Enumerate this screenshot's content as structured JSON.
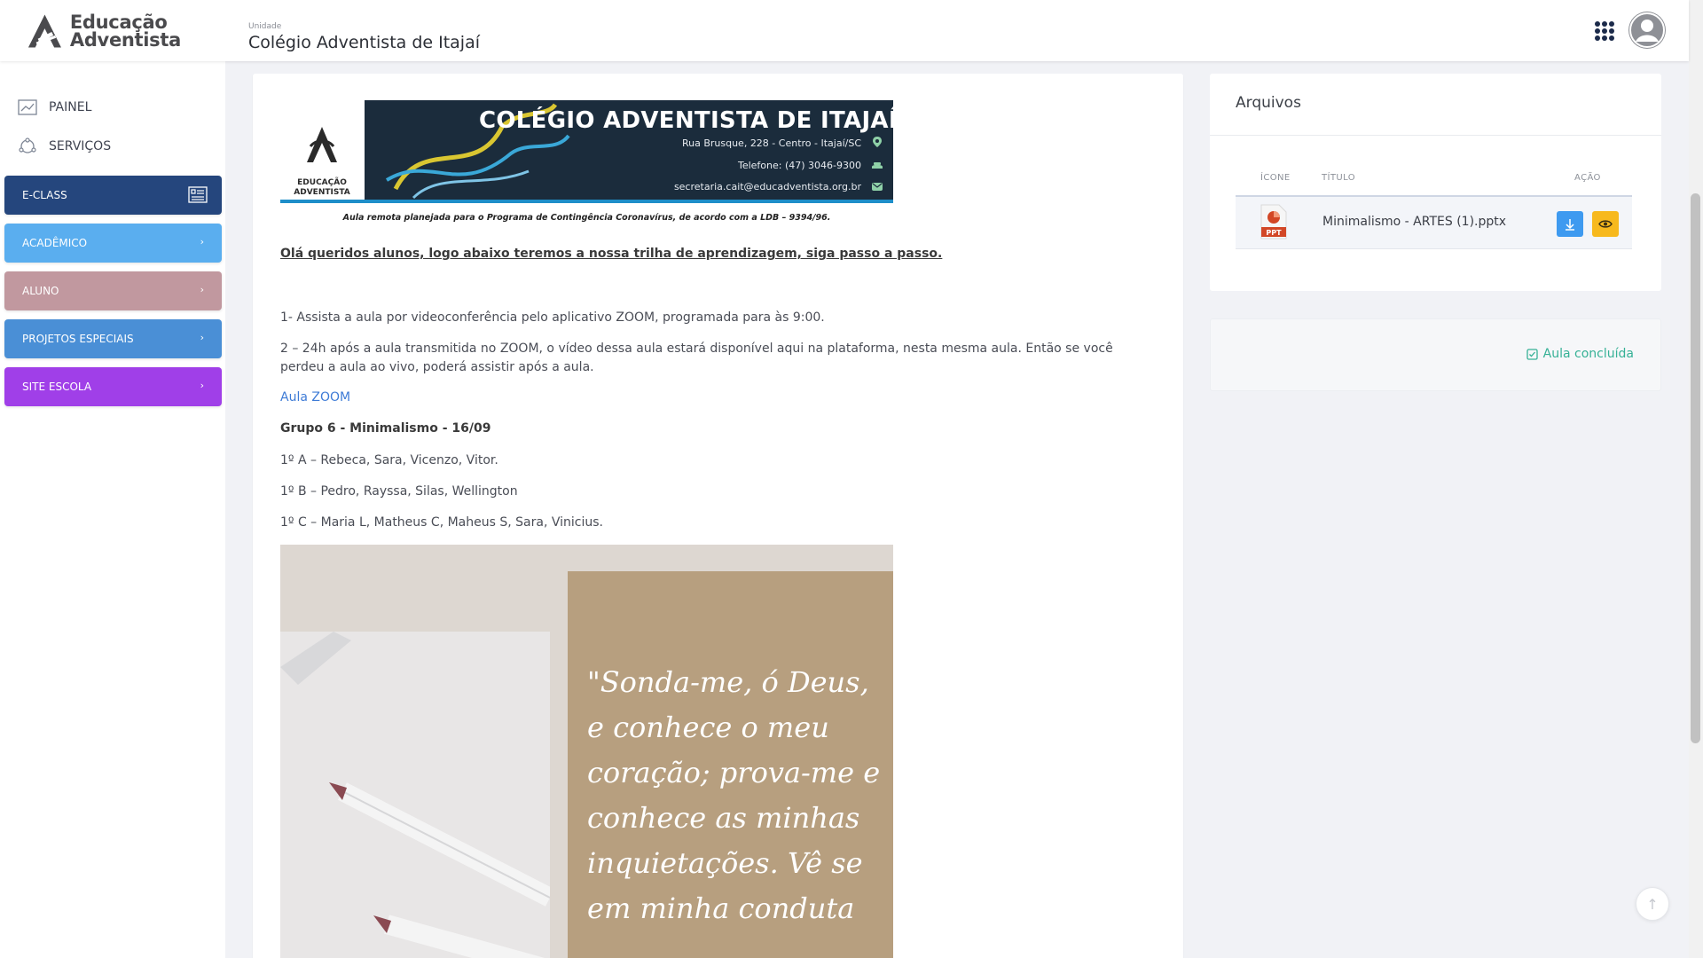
{
  "header": {
    "logo_line1": "Educação",
    "logo_line2": "Adventista",
    "unit_label": "Unidade",
    "unit_name": "Colégio Adventista de Itajaí",
    "apps_icon": "apps-grid-icon",
    "avatar_icon": "user-avatar-icon"
  },
  "sidebar": {
    "links": [
      {
        "label": "PAINEL",
        "icon": "chart-icon"
      },
      {
        "label": "SERVIÇOS",
        "icon": "services-icon"
      }
    ],
    "buttons": [
      {
        "label": "E-CLASS",
        "color": "#25467d",
        "icon": "eclass-icon"
      },
      {
        "label": "ACADÊMICO",
        "color": "#5aaeef",
        "icon": "chevron-right-icon"
      },
      {
        "label": "ALUNO",
        "color": "#c1989f",
        "icon": "chevron-right-icon"
      },
      {
        "label": "PROJETOS ESPECIAIS",
        "color": "#4a8fd6",
        "icon": "chevron-right-icon"
      },
      {
        "label": "SITE ESCOLA",
        "color": "#a03fe8",
        "icon": "chevron-right-icon"
      }
    ]
  },
  "lesson": {
    "banner": {
      "title": "COLÉGIO ADVENTISTA DE ITAJAÍ",
      "address": "Rua Brusque, 228 - Centro - Itajaí/SC",
      "phone": "Telefone: (47) 3046-9300",
      "email": "secretaria.cait@educadventista.org.br",
      "logo_text1": "EDUCAÇÃO",
      "logo_text2": "ADVENTISTA"
    },
    "caption": "Aula remota planejada para o Programa de Contingência Coronavírus, de acordo com a LDB – 9394/96.",
    "intro": "Olá queridos alunos, logo abaixo teremos a nossa trilha de aprendizagem, siga passo a passo.",
    "step1": "1- Assista a aula por videoconferência pelo aplicativo ZOOM, programada para às 9:00.",
    "step2": "2 – 24h após a aula transmitida no ZOOM,  o vídeo dessa aula estará disponível aqui na plataforma, nesta mesma aula. Então se você perdeu a aula ao vivo, poderá assistir após a aula.",
    "zoom_link": "Aula ZOOM",
    "group_title": "Grupo 6 - Minimalismo - 16/09",
    "groups": [
      "1º A – Rebeca, Sara, Vicenzo, Vitor.",
      "1º B – Pedro, Rayssa, Silas, Wellington",
      "1º C – Maria L, Matheus C, Maheus S, Sara, Vinicius."
    ],
    "quote": "\"Sonda-me, ó Deus, e conhece o meu coração; prova-me e conhece as minhas inquietações. Vê se em minha conduta"
  },
  "files": {
    "title": "Arquivos",
    "columns": [
      "ÍCONE",
      "TÍTULO",
      "AÇÃO"
    ],
    "rows": [
      {
        "icon": "ppt-file-icon",
        "icon_label": "PPT",
        "name": "Minimalismo - ARTES (1).pptx",
        "actions": [
          "download-icon",
          "eye-icon"
        ]
      }
    ]
  },
  "completion": {
    "label": "Aula concluída",
    "icon": "check-square-icon"
  },
  "back_to_top_icon": "arrow-up-icon"
}
